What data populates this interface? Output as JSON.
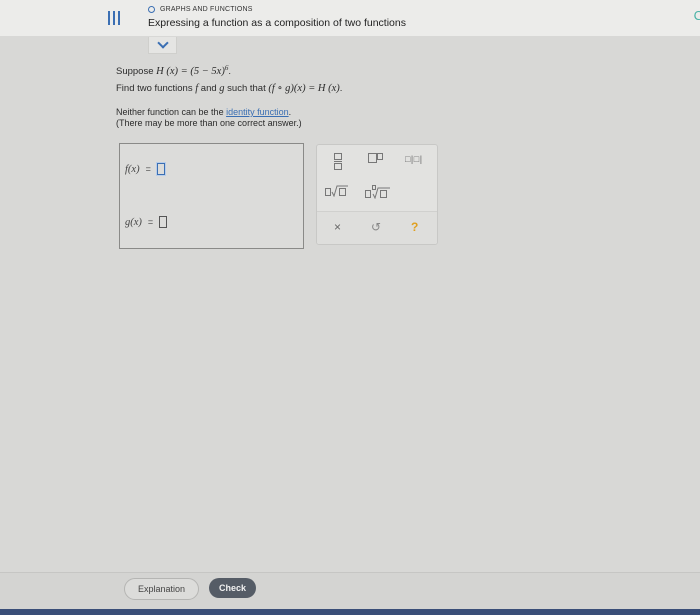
{
  "header": {
    "section": "GRAPHS AND FUNCTIONS",
    "title": "Expressing a function as a composition of two functions"
  },
  "problem": {
    "line1_prefix": "Suppose ",
    "line1_math": "H (x) = (5 − 5x)",
    "line1_exponent": "6",
    "line1_end": ".",
    "line2_prefix": "Find two functions ",
    "line2_f": "f",
    "line2_and": " and ",
    "line2_g": "g",
    "line2_mid": " such that ",
    "line2_math": "(f ∘ g)(x) = H (x)",
    "line2_end": ".",
    "line3_prefix": "Neither function can be the ",
    "line3_link": "identity function",
    "line3_end": ".",
    "line4": "(There may be more than one correct answer.)"
  },
  "answer": {
    "f_label": "f(x)",
    "g_label": "g(x)",
    "equals": "="
  },
  "palette": {
    "abs_symbol": "□|□|",
    "clear_symbol": "×",
    "undo_symbol": "↺",
    "help_symbol": "?"
  },
  "footer": {
    "explanation_label": "Explanation",
    "check_label": "Check"
  }
}
